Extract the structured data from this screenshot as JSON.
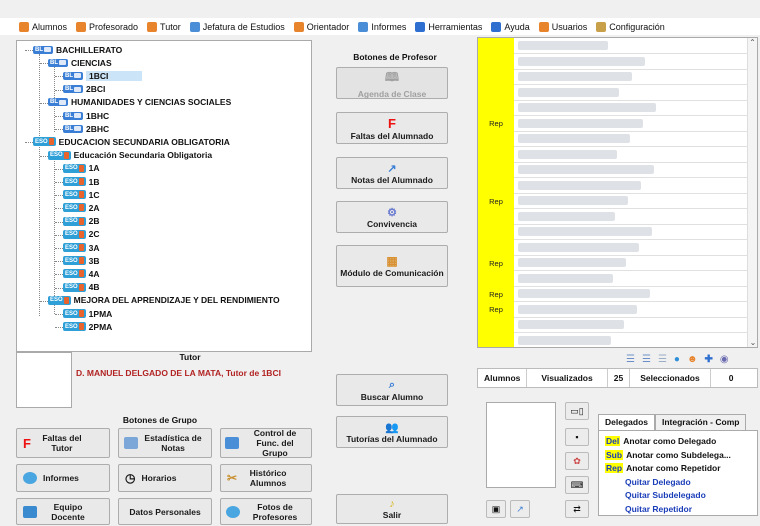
{
  "menu": [
    {
      "label": "Alumnos",
      "color": "#e8842c"
    },
    {
      "label": "Profesorado",
      "color": "#e8842c"
    },
    {
      "label": "Tutor",
      "color": "#e8842c"
    },
    {
      "label": "Jefatura de Estudios",
      "color": "#4a8ed8"
    },
    {
      "label": "Orientador",
      "color": "#e8842c"
    },
    {
      "label": "Informes",
      "color": "#4a8ed8"
    },
    {
      "label": "Herramientas",
      "color": "#2f6fd0"
    },
    {
      "label": "Ayuda",
      "color": "#2f6fd0"
    },
    {
      "label": "Usuarios",
      "color": "#e8842c"
    },
    {
      "label": "Configuración",
      "color": "#c9a04a"
    }
  ],
  "tree": [
    {
      "badge": "BL",
      "label": "BACHILLERATO",
      "level": 0
    },
    {
      "badge": "BL",
      "label": "CIENCIAS",
      "level": 1
    },
    {
      "badge": "BL",
      "label": "1BCI",
      "level": 2,
      "selected": true
    },
    {
      "badge": "BL",
      "label": "2BCI",
      "level": 2
    },
    {
      "badge": "BL",
      "label": "HUMANIDADES Y CIENCIAS SOCIALES",
      "level": 1
    },
    {
      "badge": "BL",
      "label": "1BHC",
      "level": 2
    },
    {
      "badge": "BL",
      "label": "2BHC",
      "level": 2
    },
    {
      "badge": "ESO",
      "label": "EDUCACION SECUNDARIA OBLIGATORIA",
      "level": 0
    },
    {
      "badge": "ESO",
      "label": "Educación Secundaria Obligatoria",
      "level": 1
    },
    {
      "badge": "ESO",
      "label": "1A",
      "level": 2
    },
    {
      "badge": "ESO",
      "label": "1B",
      "level": 2
    },
    {
      "badge": "ESO",
      "label": "1C",
      "level": 2
    },
    {
      "badge": "ESO",
      "label": "2A",
      "level": 2
    },
    {
      "badge": "ESO",
      "label": "2B",
      "level": 2
    },
    {
      "badge": "ESO",
      "label": "2C",
      "level": 2
    },
    {
      "badge": "ESO",
      "label": "3A",
      "level": 2
    },
    {
      "badge": "ESO",
      "label": "3B",
      "level": 2
    },
    {
      "badge": "ESO",
      "label": "4A",
      "level": 2
    },
    {
      "badge": "ESO",
      "label": "4B",
      "level": 2
    },
    {
      "badge": "ESO",
      "label": "MEJORA DEL APRENDIZAJE Y DEL RENDIMIENTO",
      "level": 1
    },
    {
      "badge": "ESO",
      "label": "1PMA",
      "level": 2
    },
    {
      "badge": "ESO",
      "label": "2PMA",
      "level": 2
    }
  ],
  "tutor": {
    "heading": "Tutor",
    "name": "D. MANUEL DELGADO DE LA MATA, Tutor de 1BCI"
  },
  "profesor": {
    "heading": "Botones de Profesor",
    "agenda": "Agenda de Clase",
    "faltas": "Faltas del Alumnado",
    "notas": "Notas del Alumnado",
    "convivencia": "Convivencia",
    "modulo": "Módulo de Comunicación",
    "buscar": "Buscar Alumno",
    "tutorias": "Tutorías del Alumnado",
    "salir": "Salir"
  },
  "grupo": {
    "heading": "Botones de Grupo",
    "faltas_tutor": "Faltas del Tutor",
    "estadistica": "Estadística de Notas",
    "control": "Control de Func. del Grupo",
    "informes": "Informes",
    "horarios": "Horarios",
    "historico": "Histórico Alumnos",
    "equipo": "Equipo Docente",
    "datos": "Datos Personales",
    "fotos": "Fotos de Profesores"
  },
  "students": {
    "rep_marks": [
      "",
      "",
      "",
      "",
      "",
      "Rep",
      "",
      "",
      "",
      "",
      "Rep",
      "",
      "",
      "",
      "Rep",
      "",
      "Rep",
      "Rep",
      "",
      ""
    ]
  },
  "summary": {
    "alumnos": "Alumnos",
    "visualizados": "Visualizados",
    "visualizados_count": "25",
    "seleccionados": "Seleccionados",
    "seleccionados_count": "0"
  },
  "tabs": {
    "delegados": "Delegados",
    "integracion": "Integración - Comp"
  },
  "options": [
    {
      "tag": "Del",
      "label": "Anotar como Delegado"
    },
    {
      "tag": "Sub",
      "label": "Anotar como Subdelega..."
    },
    {
      "tag": "Rep",
      "label": "Anotar como Repetidor"
    },
    {
      "tag": "",
      "label": "Quitar Delegado"
    },
    {
      "tag": "",
      "label": "Quitar Subdelegado"
    },
    {
      "tag": "",
      "label": "Quitar Repetidor"
    }
  ]
}
